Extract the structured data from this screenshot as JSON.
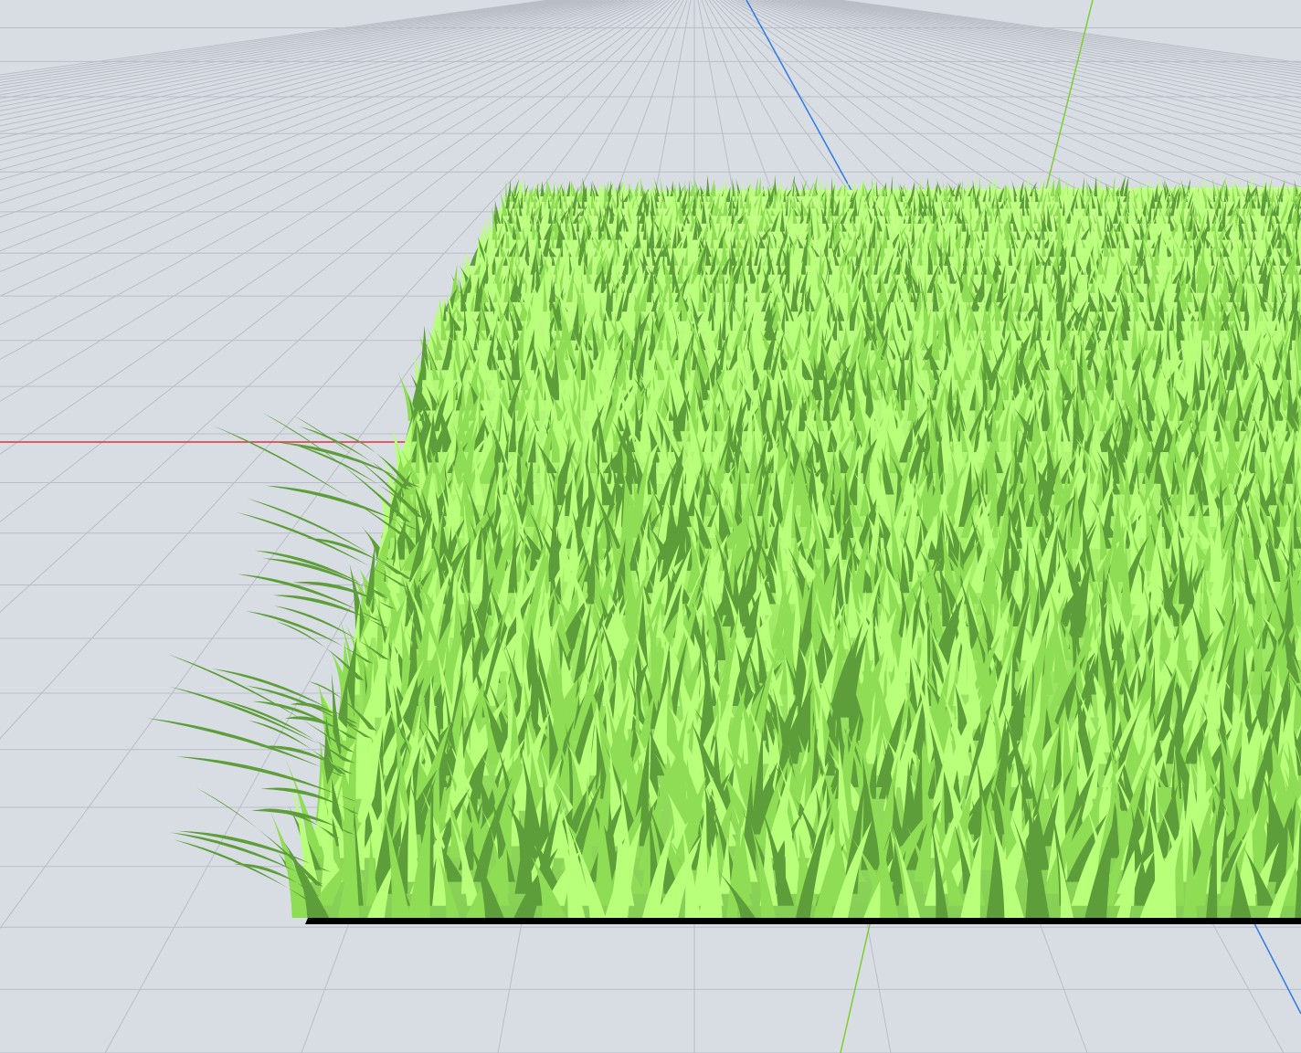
{
  "scene": {
    "background_color": "#d8dde4",
    "grid_color": "#b9bec6",
    "axes": {
      "x_axis_color": "#e0323c",
      "y_axis_color": "#7ccf2e",
      "z_axis_color": "#2f7be6"
    },
    "grass": {
      "base_color": "#000000",
      "blade_light": "#b8ff7a",
      "blade_mid": "#8fdc55",
      "blade_dark": "#5e9e3a"
    }
  }
}
